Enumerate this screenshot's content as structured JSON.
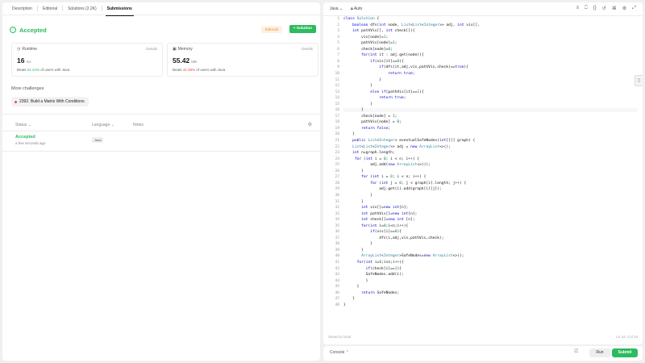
{
  "left_tabs": [
    "Description",
    "Editorial",
    "Solutions (2.2K)",
    "Submissions"
  ],
  "active_tab_index": 3,
  "result": {
    "title": "Accepted",
    "editorial_button": "Editorial",
    "solution_button": "+ Solution"
  },
  "runtime": {
    "label": "Runtime",
    "details": "Details",
    "value": "16",
    "unit": "ms",
    "beats_prefix": "Beats ",
    "beats_pct": "51.24%",
    "beats_suffix": " of users with Java"
  },
  "memory": {
    "label": "Memory",
    "details": "Details",
    "value": "55.42",
    "unit": "MB",
    "beats_prefix": "Beats ",
    "beats_pct": "42.38%",
    "beats_suffix": " of users with Java"
  },
  "more_challenges": {
    "title": "More challenges",
    "items": [
      "2392. Build a Matrix With Conditions"
    ]
  },
  "table": {
    "headers": {
      "status": "Status",
      "language": "Language",
      "notes": "Notes"
    },
    "rows": [
      {
        "status": "Accepted",
        "time": "a few seconds ago",
        "language": "Java"
      }
    ]
  },
  "editor": {
    "language": "Java",
    "mode": "Auto",
    "saved": "Saved to local",
    "cursor": "Ln 16, Col 10",
    "active_line": 16,
    "lines": [
      "class Solution {",
      "    boolean dfs(int node, List<List<Integer>> adj, int vis[],",
      "    int pathVis[], int check[]){",
      "        vis[node]=1;",
      "        pathVis[node]=1;",
      "        check[node]=0;",
      "        for(int it : adj.get(node)){",
      "            if(vis[it]==0){",
      "                if(dfs(it,adj,vis,pathVis,check)==true){",
      "                    return true;",
      "                }",
      "            }",
      "            else if(pathVis[it]==1){",
      "                return true;",
      "            }",
      "        }",
      "        check[node] = 1;",
      "        pathVis[node] = 0;",
      "        return false;",
      "    }",
      "    public List<Integer> eventualSafeNodes(int[][] graph) {",
      "    List<List<Integer>> adj = new ArrayList<>();",
      "    int n=graph.length;",
      "     for (int i = 0; i < n; i++) {",
      "            adj.add(new ArrayList<>());",
      "        }",
      "        for (int i = 0; i < n; i++) {",
      "            for (int j = 0; j < graph[i].length; j++) {",
      "                adj.get(i).add(graph[i][j]);",
      "            }",
      "        }",
      "        int vis[]=new int[n];",
      "        int pathVis[]=new int[n];",
      "        int check[]=new int [n];",
      "        for(int i=0;i<n;i++){",
      "            if(vis[i]==0){",
      "                dfs(i,adj,vis,pathVis,check);",
      "            }",
      "        }",
      "        ArrayList<Integer>SafeNodes=new ArrayList<>();",
      "      for(int i=0;i<n;i++){",
      "          if(check[i]==1){",
      "          SafeNodes.add(i);",
      "          }",
      "      }",
      "        return SafeNodes;",
      "    }",
      "}"
    ]
  },
  "console": {
    "label": "Console",
    "run": "Run",
    "submit": "Submit"
  }
}
